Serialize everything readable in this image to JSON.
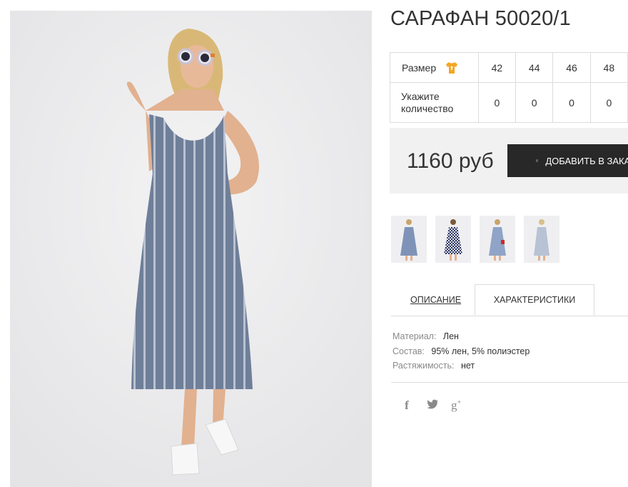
{
  "product": {
    "title": "САРАФАН 50020/1",
    "main_image_alt": "Женщина в полосатом сарафане"
  },
  "size_table": {
    "size_label": "Размер",
    "qty_label": "Укажите количество",
    "sizes": [
      "42",
      "44",
      "46",
      "48"
    ],
    "quantities": [
      "0",
      "0",
      "0",
      "0"
    ],
    "size_icon": "tshirt-icon"
  },
  "buy": {
    "price": "1160 руб",
    "add_label": "ДОБАВИТЬ В ЗАКАЗ",
    "bag_icon": "shopping-bag-icon"
  },
  "thumbnails": [
    "thumb-1",
    "thumb-2",
    "thumb-3",
    "thumb-4"
  ],
  "tabs": {
    "description": "ОПИСАНИЕ",
    "characteristics": "ХАРАКТЕРИСТИКИ"
  },
  "specs": [
    {
      "key": "Материал:",
      "value": "Лен"
    },
    {
      "key": "Состав:",
      "value": "95% лен, 5% полиэстер"
    },
    {
      "key": "Растяжимость:",
      "value": "нет"
    }
  ],
  "social": {
    "facebook": "f",
    "twitter": "twitter-icon",
    "googleplus": "g",
    "googleplus_sup": "+"
  },
  "colors": {
    "button_bg": "#282828",
    "panel_bg": "#f1f1f1",
    "icon_accent": "#f5a623"
  }
}
